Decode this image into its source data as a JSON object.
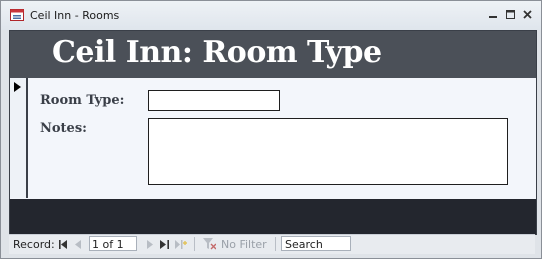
{
  "window": {
    "title": "Ceil Inn - Rooms"
  },
  "form": {
    "header_title": "Ceil Inn: Room Type",
    "fields": {
      "room_type_label": "Room Type:",
      "room_type_value": "",
      "notes_label": "Notes:",
      "notes_value": ""
    }
  },
  "navigation": {
    "record_label": "Record:",
    "record_position": "1 of 1",
    "filter_label": "No Filter",
    "search_placeholder": "Search"
  },
  "icons": {
    "app": "access-form-icon",
    "minimize": "minimize-icon",
    "restore": "restore-icon",
    "close": "close-icon",
    "first": "first-record-icon",
    "prev": "previous-record-icon",
    "next": "next-record-icon",
    "last": "last-record-icon",
    "new": "new-record-icon",
    "filter": "filter-icon"
  },
  "colors": {
    "header": "#4b5058",
    "footer": "#23262e",
    "detail": "#f3f6fb"
  }
}
